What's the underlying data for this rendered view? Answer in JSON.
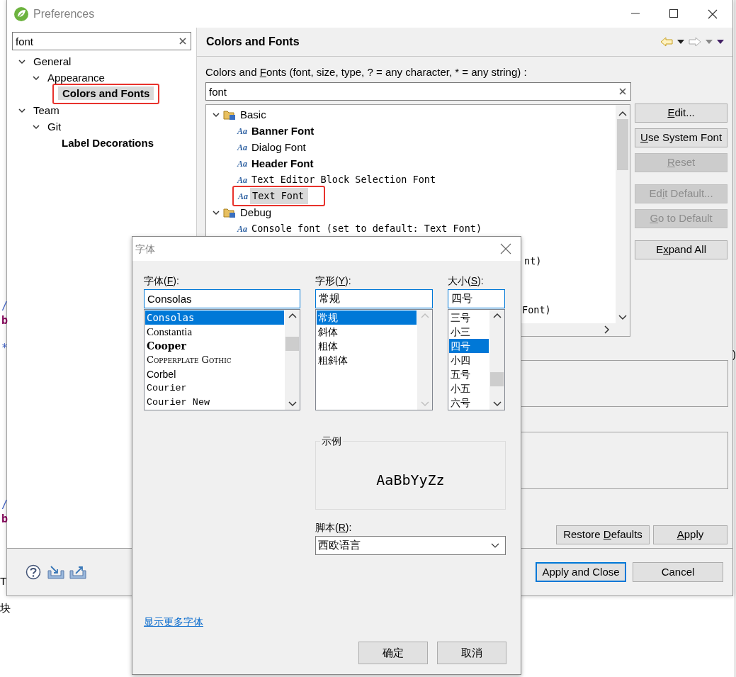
{
  "preferences": {
    "title": "Preferences",
    "filter": {
      "value": "font"
    },
    "tree": [
      {
        "label": "General",
        "expanded": true,
        "selected": false,
        "bold": false,
        "highlighted": false,
        "children": [
          {
            "label": "Appearance",
            "expanded": true,
            "selected": false,
            "bold": false,
            "highlighted": false,
            "children": [
              {
                "label": "Colors and Fonts",
                "selected": true,
                "bold": true,
                "highlighted": true
              }
            ]
          }
        ]
      },
      {
        "label": "Team",
        "expanded": true,
        "selected": false,
        "bold": false,
        "highlighted": false,
        "children": [
          {
            "label": "Git",
            "expanded": true,
            "selected": false,
            "bold": false,
            "highlighted": false,
            "children": [
              {
                "label": "Label Decorations",
                "selected": false,
                "bold": true,
                "highlighted": false
              }
            ]
          }
        ]
      }
    ],
    "page_title": "Colors and Fonts",
    "filter_label": {
      "before": "Colors and ",
      "underlined": "F",
      "after": "onts (font, size, type, ? = any character, * = any string) :"
    },
    "font_filter": {
      "value": "font"
    },
    "font_tree": [
      {
        "label": "Basic",
        "expanded": true,
        "children": [
          {
            "icon": "Aa",
            "label": "Banner Font",
            "kind": "bold",
            "selected": false,
            "highlighted": false
          },
          {
            "icon": "Aa",
            "label": "Dialog Font",
            "kind": "regular",
            "selected": false,
            "highlighted": false
          },
          {
            "icon": "Aa",
            "label": "Header Font",
            "kind": "bold",
            "selected": false,
            "highlighted": false
          },
          {
            "icon": "Aa",
            "label": "Text Editor Block Selection Font",
            "kind": "mono",
            "selected": false,
            "highlighted": false
          },
          {
            "icon": "Aa",
            "label": "Text Font",
            "kind": "mono",
            "selected": true,
            "highlighted": true
          }
        ]
      },
      {
        "label": "Debug",
        "expanded": true,
        "children": [
          {
            "icon": "Aa",
            "label": "Console font (set to default: Text Font)",
            "kind": "mono",
            "selected": false,
            "highlighted": false
          },
          {
            "label": "nt)",
            "kind": "fragment",
            "selected": false,
            "highlighted": false
          },
          {
            "label": "Font)",
            "kind": "fragment",
            "selected": false,
            "highlighted": false
          }
        ]
      }
    ],
    "button_groups": [
      [
        {
          "underlined": "E",
          "after": "dit...",
          "disabled": false
        },
        {
          "underlined": "U",
          "after": "se System Font",
          "disabled": false
        },
        {
          "underlined": "R",
          "after": "eset",
          "disabled": true
        }
      ],
      [
        {
          "before": "Ed",
          "underlined": "i",
          "after": "t Default...",
          "disabled": true
        },
        {
          "underlined": "G",
          "after": "o to Default",
          "disabled": true
        }
      ],
      [
        {
          "before": "E",
          "underlined": "x",
          "after": "pand All",
          "disabled": false
        }
      ]
    ],
    "restore_defaults": {
      "before": "Restore ",
      "underlined": "D",
      "after": "efaults"
    },
    "apply": {
      "underlined": "A",
      "after": "pply"
    },
    "apply_and_close": {
      "label": "Apply and Close",
      "focused": true
    },
    "cancel": {
      "label": "Cancel",
      "focused": false
    }
  },
  "font_dialog": {
    "title": "字体",
    "family": {
      "label": {
        "before": "字体(",
        "underlined": "F",
        "after": "):"
      },
      "value": "Consolas",
      "options": [
        {
          "label": "Consolas",
          "kind": "mono",
          "selected": true
        },
        {
          "label": "Constantia",
          "kind": "serif",
          "selected": false
        },
        {
          "label": "Cooper",
          "kind": "heavy",
          "selected": false
        },
        {
          "label": "Copperplate Gothic",
          "kind": "smallcaps",
          "selected": false
        },
        {
          "label": "Corbel",
          "kind": "sans",
          "selected": false
        },
        {
          "label": "Courier",
          "kind": "courier",
          "selected": false
        },
        {
          "label": "Courier New",
          "kind": "courier",
          "selected": false
        }
      ]
    },
    "style": {
      "label": {
        "before": "字形(",
        "underlined": "Y",
        "after": "):"
      },
      "value": "常规",
      "options": [
        {
          "label": "常规",
          "selected": true
        },
        {
          "label": "斜体",
          "selected": false
        },
        {
          "label": "粗体",
          "selected": false
        },
        {
          "label": "粗斜体",
          "selected": false
        }
      ]
    },
    "size": {
      "label": {
        "before": "大小(",
        "underlined": "S",
        "after": "):"
      },
      "value": "四号",
      "options": [
        {
          "label": "三号",
          "selected": false
        },
        {
          "label": "小三",
          "selected": false
        },
        {
          "label": "四号",
          "selected": true
        },
        {
          "label": "小四",
          "selected": false
        },
        {
          "label": "五号",
          "selected": false
        },
        {
          "label": "小五",
          "selected": false
        },
        {
          "label": "六号",
          "selected": false
        }
      ]
    },
    "sample": {
      "legend": "示例",
      "text": "AaBbYyZz"
    },
    "script": {
      "label": {
        "before": "脚本(",
        "underlined": "R",
        "after": "):"
      },
      "value": "西欧语言"
    },
    "more_fonts_link": "显示更多字体",
    "ok": "确定",
    "cancel": "取消"
  },
  "background_fragments": [
    {
      "text": "/",
      "kind": "comment"
    },
    {
      "text": "b",
      "kind": "keyword"
    },
    {
      "text": "*",
      "kind": "comment"
    },
    {
      "text": "/",
      "kind": "comment"
    },
    {
      "text": "b",
      "kind": "keyword"
    },
    {
      "text": "T",
      "kind": "plain"
    },
    {
      "text": "块",
      "kind": "plain"
    },
    {
      "text": ")",
      "kind": "plain"
    }
  ]
}
